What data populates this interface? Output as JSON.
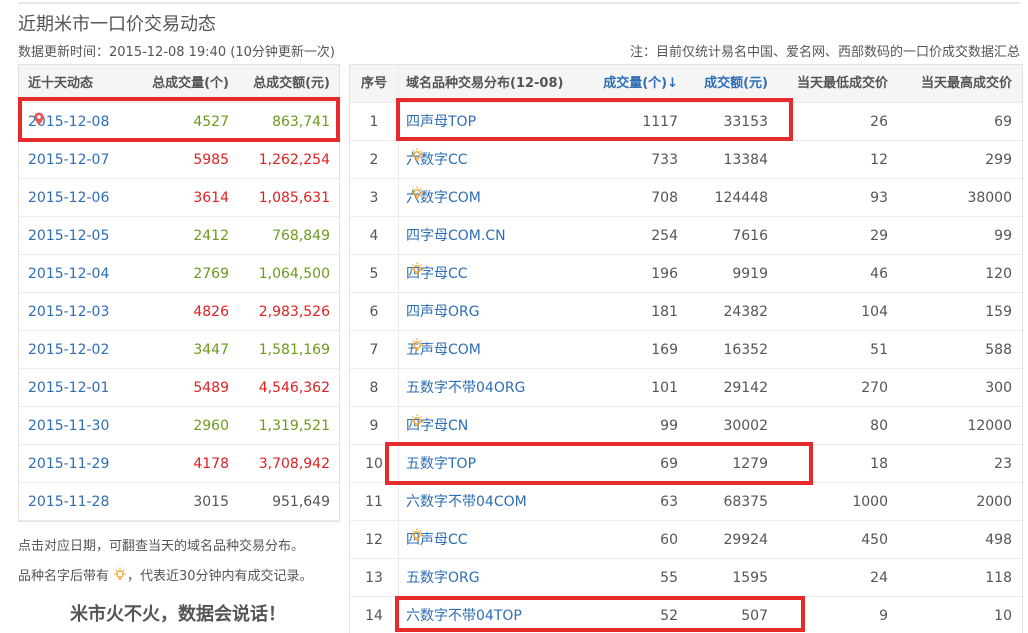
{
  "header": {
    "title": "近期米市一口价交易动态",
    "update_time": "数据更新时间：2015-12-08 19:40 (10分钟更新一次)",
    "notice": "注：目前仅统计易名中国、爱名网、西部数码的一口价成交数据汇总"
  },
  "left_table": {
    "headers": {
      "date": "近十天动态",
      "volume": "总成交量(个)",
      "amount": "总成交额(元)"
    },
    "rows": [
      {
        "date": "2015-12-08",
        "volume": "4527",
        "amount": "863,741",
        "color": "green",
        "current": true
      },
      {
        "date": "2015-12-07",
        "volume": "5985",
        "amount": "1,262,254",
        "color": "red"
      },
      {
        "date": "2015-12-06",
        "volume": "3614",
        "amount": "1,085,631",
        "color": "red"
      },
      {
        "date": "2015-12-05",
        "volume": "2412",
        "amount": "768,849",
        "color": "green"
      },
      {
        "date": "2015-12-04",
        "volume": "2769",
        "amount": "1,064,500",
        "color": "green"
      },
      {
        "date": "2015-12-03",
        "volume": "4826",
        "amount": "2,983,526",
        "color": "red"
      },
      {
        "date": "2015-12-02",
        "volume": "3447",
        "amount": "1,581,169",
        "color": "green"
      },
      {
        "date": "2015-12-01",
        "volume": "5489",
        "amount": "4,546,362",
        "color": "red"
      },
      {
        "date": "2015-11-30",
        "volume": "2960",
        "amount": "1,319,521",
        "color": "green"
      },
      {
        "date": "2015-11-29",
        "volume": "4178",
        "amount": "3,708,942",
        "color": "red"
      },
      {
        "date": "2015-11-28",
        "volume": "3015",
        "amount": "951,649",
        "color": "black"
      }
    ]
  },
  "hints": {
    "line1": "点击对应日期，可翻查当天的域名品种交易分布。",
    "line2_a": "品种名字后带有",
    "line2_b": "，代表近30分钟内有成交记录。",
    "slogan": "米市火不火，数据会说话！"
  },
  "right_table": {
    "headers": {
      "index": "序号",
      "name": "域名品种交易分布(12-08)",
      "volume": "成交量(个)↓",
      "amount": "成交额(元)",
      "low": "当天最低成交价",
      "high": "当天最高成交价"
    },
    "rows": [
      {
        "index": "1",
        "name": "四声母TOP",
        "recent": false,
        "volume": "1117",
        "amount": "33153",
        "low": "26",
        "high": "69"
      },
      {
        "index": "2",
        "name": "六数字CC",
        "recent": true,
        "volume": "733",
        "amount": "13384",
        "low": "12",
        "high": "299"
      },
      {
        "index": "3",
        "name": "六数字COM",
        "recent": true,
        "volume": "708",
        "amount": "124448",
        "low": "93",
        "high": "38000"
      },
      {
        "index": "4",
        "name": "四字母COM.CN",
        "recent": false,
        "volume": "254",
        "amount": "7616",
        "low": "29",
        "high": "99"
      },
      {
        "index": "5",
        "name": "四字母CC",
        "recent": true,
        "volume": "196",
        "amount": "9919",
        "low": "46",
        "high": "120"
      },
      {
        "index": "6",
        "name": "四声母ORG",
        "recent": false,
        "volume": "181",
        "amount": "24382",
        "low": "104",
        "high": "159"
      },
      {
        "index": "7",
        "name": "五声母COM",
        "recent": true,
        "volume": "169",
        "amount": "16352",
        "low": "51",
        "high": "588"
      },
      {
        "index": "8",
        "name": "五数字不带04ORG",
        "recent": false,
        "volume": "101",
        "amount": "29142",
        "low": "270",
        "high": "300"
      },
      {
        "index": "9",
        "name": "四字母CN",
        "recent": true,
        "volume": "99",
        "amount": "30002",
        "low": "80",
        "high": "12000"
      },
      {
        "index": "10",
        "name": "五数字TOP",
        "recent": false,
        "volume": "69",
        "amount": "1279",
        "low": "18",
        "high": "23"
      },
      {
        "index": "11",
        "name": "六数字不带04COM",
        "recent": false,
        "volume": "63",
        "amount": "68375",
        "low": "1000",
        "high": "2000"
      },
      {
        "index": "12",
        "name": "四声母CC",
        "recent": true,
        "volume": "60",
        "amount": "29924",
        "low": "450",
        "high": "498"
      },
      {
        "index": "13",
        "name": "五数字ORG",
        "recent": false,
        "volume": "55",
        "amount": "1595",
        "low": "24",
        "high": "118"
      },
      {
        "index": "14",
        "name": "六数字不带04TOP",
        "recent": false,
        "volume": "52",
        "amount": "507",
        "low": "9",
        "high": "10"
      }
    ]
  },
  "colors": {
    "link": "#2e6eb5",
    "up": "#e02020",
    "down": "#6b9a1d",
    "highlight": "#e52b2b",
    "bulb": "#f0a020"
  },
  "icons": {
    "pin": "location-pin-icon",
    "bulb": "light-bulb-icon"
  }
}
